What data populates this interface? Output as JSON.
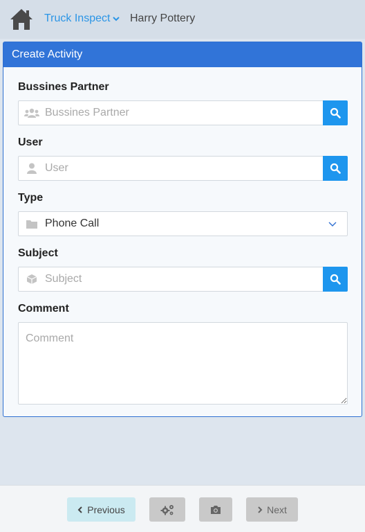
{
  "header": {
    "app_name": "Truck Inspect",
    "user_name": "Harry Pottery"
  },
  "card": {
    "title": "Create Activity"
  },
  "form": {
    "partner": {
      "label": "Bussines Partner",
      "placeholder": "Bussines Partner",
      "icon": "users-icon"
    },
    "user": {
      "label": "User",
      "placeholder": "User",
      "icon": "user-icon"
    },
    "type": {
      "label": "Type",
      "value": "Phone Call",
      "icon": "folder-icon"
    },
    "subject": {
      "label": "Subject",
      "placeholder": "Subject",
      "icon": "cube-icon"
    },
    "comment": {
      "label": "Comment",
      "placeholder": "Comment"
    }
  },
  "footer": {
    "previous_label": "Previous",
    "next_label": "Next"
  },
  "colors": {
    "accent": "#3174d8",
    "search_button": "#1e96ee",
    "link": "#2b95e6"
  }
}
